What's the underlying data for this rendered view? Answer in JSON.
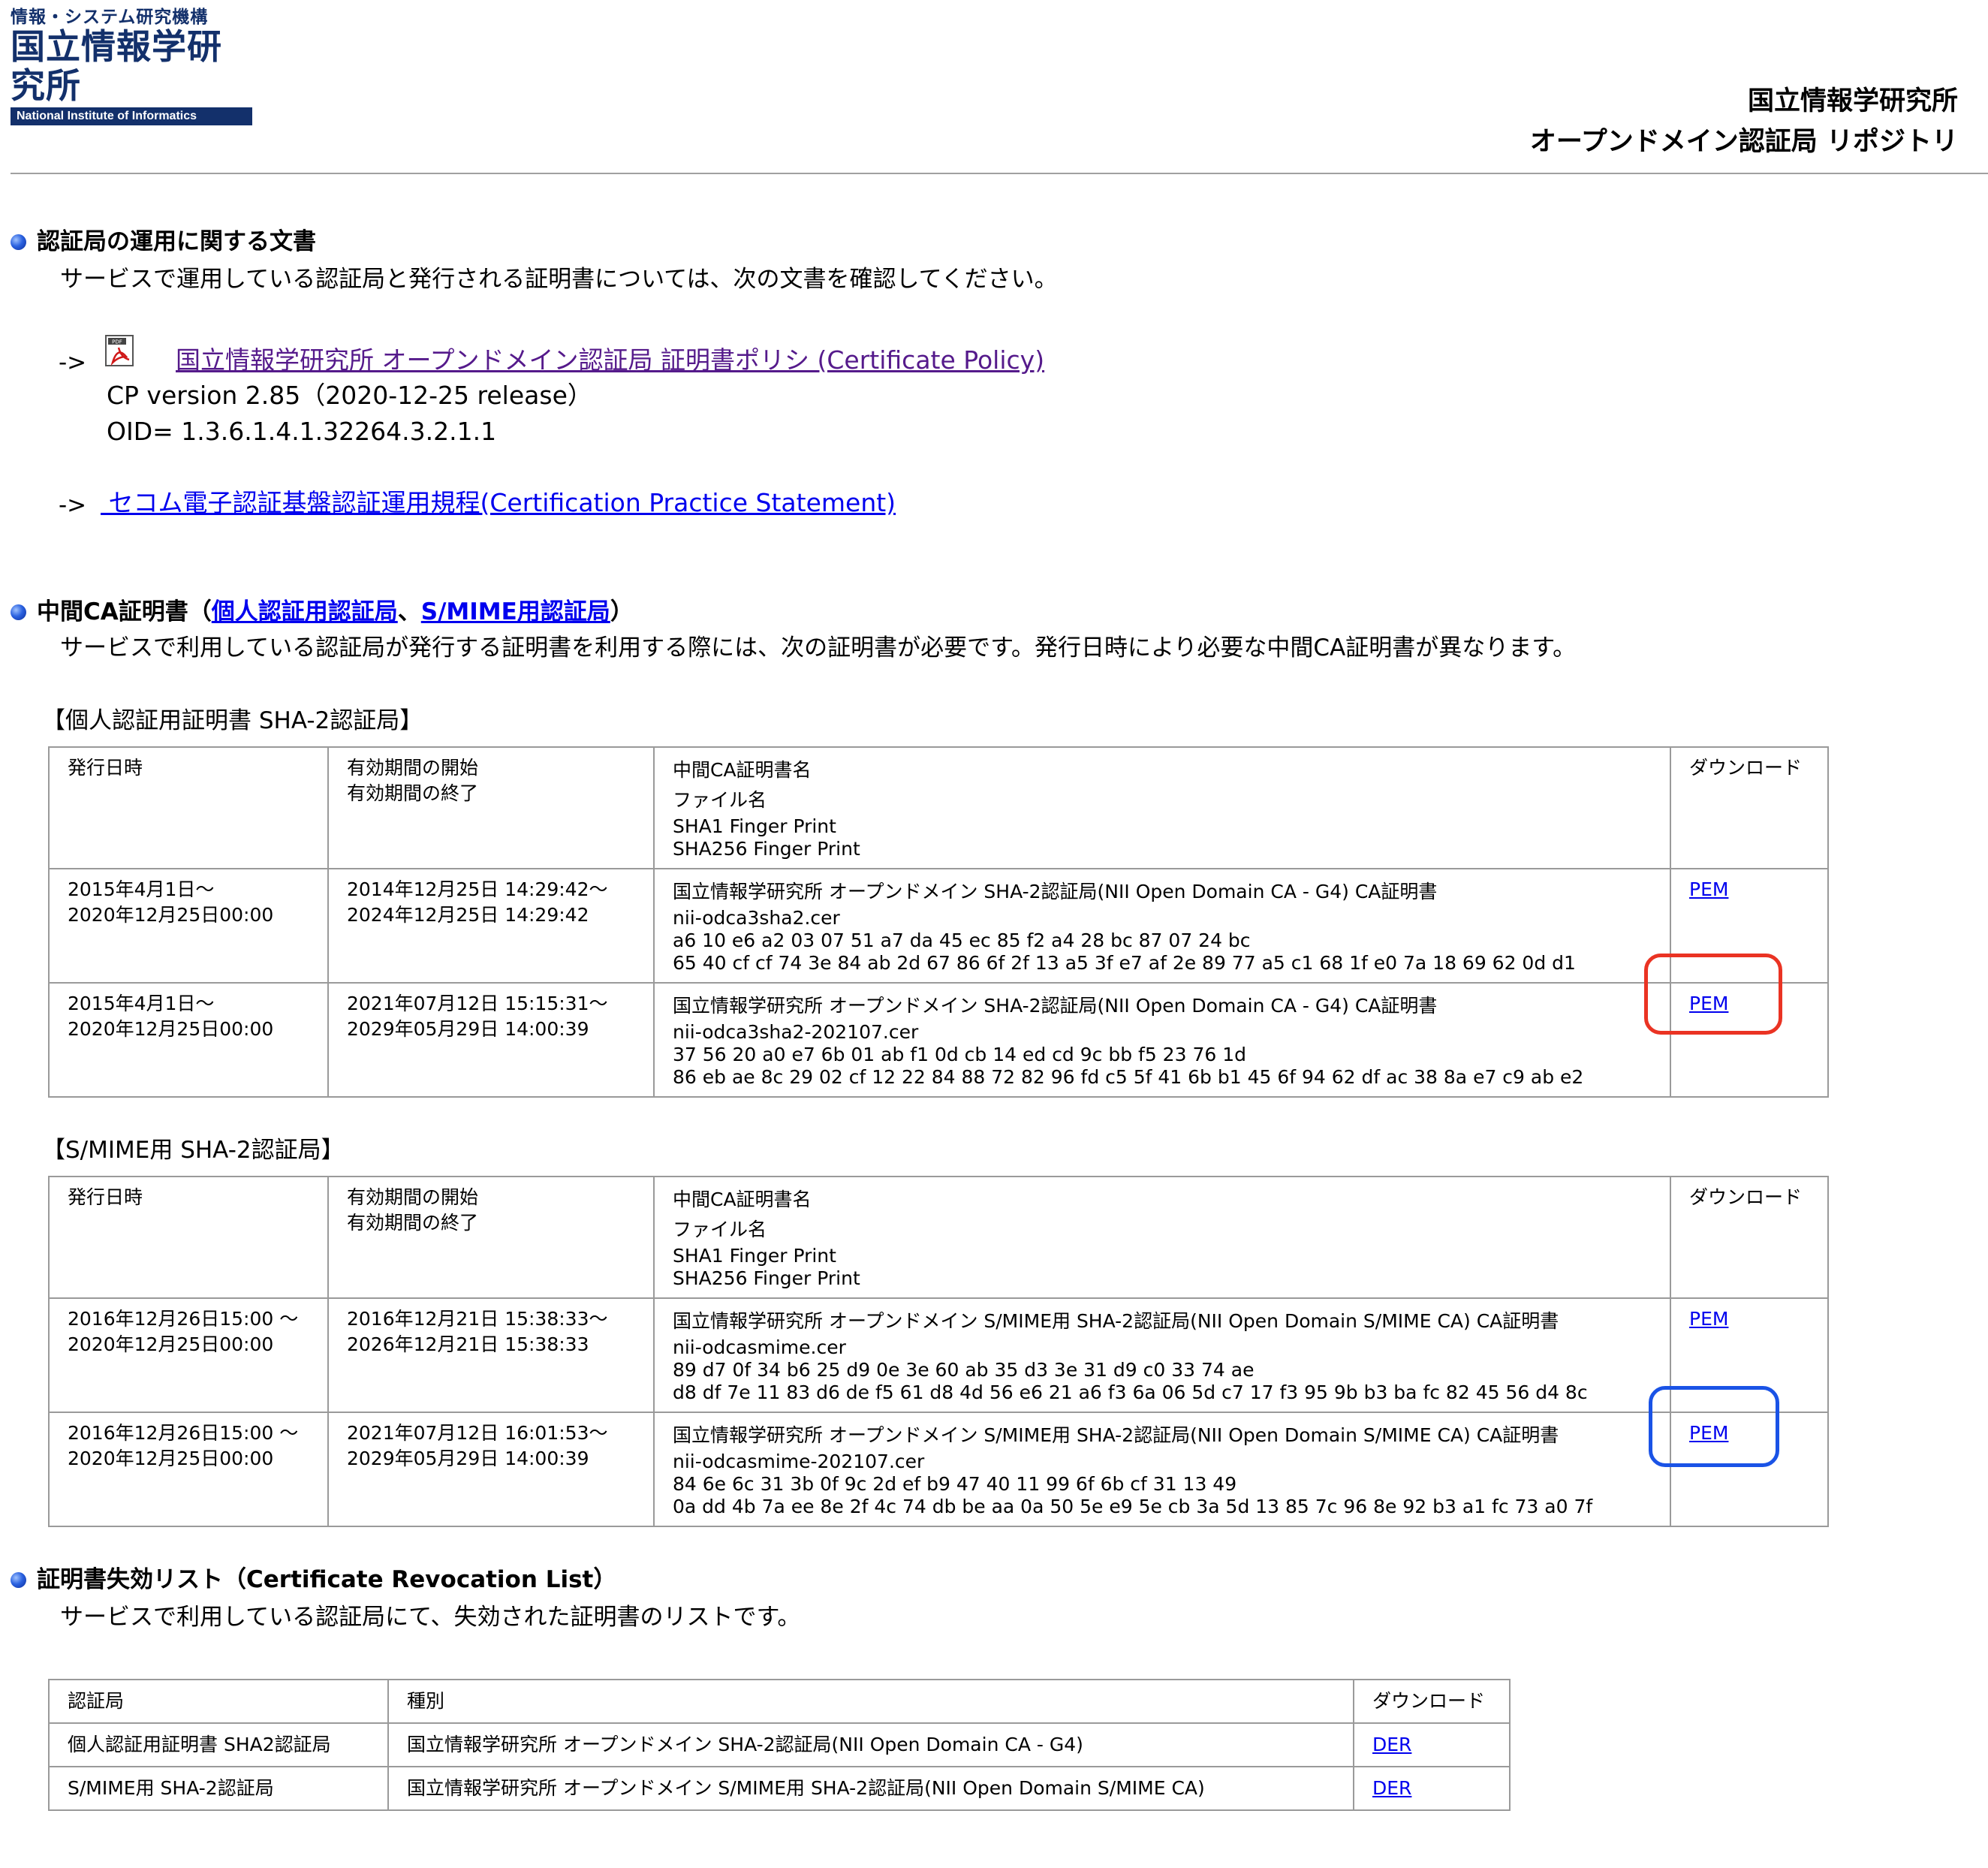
{
  "header": {
    "logo_line1": "情報・システム研究機構",
    "logo_line2": "国立情報学研究所",
    "logo_line3": "National Institute of Informatics",
    "title_line1": "国立情報学研究所",
    "title_line2": "オープンドメイン認証局 リポジトリ"
  },
  "sections": {
    "ops": {
      "heading": "認証局の運用に関する文書",
      "description": "サービスで運用している認証局と発行される証明書については、次の文書を確認してください。",
      "arrow": "->",
      "cp_link": "国立情報学研究所 オープンドメイン認証局 証明書ポリシ (Certificate Policy)",
      "cp_version": "CP version 2.85（2020-12-25 release）",
      "cp_oid": "OID= 1.3.6.1.4.1.32264.3.2.1.1",
      "cps_link": " セコム電子認証基盤認証運用規程(Certification Practice Statement)",
      "pdf_icon": "pdf-file-icon"
    },
    "intermediate": {
      "heading_prefix": "中間CA証明書（",
      "heading_link1": "個人認証用認証局",
      "heading_sep": "、",
      "heading_link2": "S/MIME用認証局",
      "heading_suffix": "）",
      "description": "サービスで利用している認証局が発行する証明書を利用する際には、次の証明書が必要です。発行日時により必要な中間CA証明書が異なります。"
    },
    "crl": {
      "heading": "証明書失効リスト（Certificate Revocation List）",
      "description": "サービスで利用している認証局にて、失効された証明書のリストです。"
    }
  },
  "table_headers": {
    "issue_date": "発行日時",
    "valid_start": "有効期間の開始",
    "valid_end": "有効期間の終了",
    "ca_name": "中間CA証明書名",
    "file_name": "ファイル名",
    "sha1": "SHA1 Finger Print",
    "sha256": "SHA256 Finger Print",
    "download": "ダウンロード"
  },
  "table_personal": {
    "title": "【個人認証用証明書 SHA-2認証局】",
    "rows": [
      {
        "issue1": "2015年4月1日〜",
        "issue2": "2020年12月25日00:00",
        "start": "2014年12月25日 14:29:42〜",
        "end": "2024年12月25日 14:29:42",
        "name": "国立情報学研究所 オープンドメイン SHA-2認証局(NII Open Domain CA - G4) CA証明書",
        "file": "nii-odca3sha2.cer",
        "sha1": "a6 10 e6 a2 03 07 51 a7 da 45 ec 85 f2 a4 28 bc 87 07 24 bc",
        "sha256": "65 40 cf cf 74 3e 84 ab 2d 67 86 6f 2f 13 a5 3f e7 af 2e 89 77 a5 c1 68 1f e0 7a 18 69 62 0d d1",
        "download": "PEM"
      },
      {
        "issue1": "2015年4月1日〜",
        "issue2": "2020年12月25日00:00",
        "start": "2021年07月12日 15:15:31〜",
        "end": "2029年05月29日 14:00:39",
        "name": "国立情報学研究所 オープンドメイン SHA-2認証局(NII Open Domain CA - G4) CA証明書",
        "file": "nii-odca3sha2-202107.cer",
        "sha1": "37 56 20 a0 e7 6b 01 ab f1 0d cb 14 ed cd 9c bb f5 23 76 1d",
        "sha256": "86 eb ae 8c 29 02 cf 12 22 84 88 72 82 96 fd c5 5f 41 6b b1 45 6f 94 62 df ac 38 8a e7 c9 ab e2",
        "download": "PEM"
      }
    ]
  },
  "table_smime": {
    "title": "【S/MIME用 SHA-2認証局】",
    "rows": [
      {
        "issue1": "2016年12月26日15:00 〜",
        "issue2": "2020年12月25日00:00",
        "start": "2016年12月21日 15:38:33〜",
        "end": "2026年12月21日 15:38:33",
        "name": "国立情報学研究所 オープンドメイン S/MIME用 SHA-2認証局(NII Open Domain S/MIME CA) CA証明書",
        "file": "nii-odcasmime.cer",
        "sha1": "89 d7 0f 34 b6 25 d9 0e 3e 60 ab 35 d3 3e 31 d9 c0 33 74 ae",
        "sha256": "d8 df 7e 11 83 d6 de f5 61 d8 4d 56 e6 21 a6 f3 6a 06 5d c7 17 f3 95 9b b3 ba fc 82 45 56 d4 8c",
        "download": "PEM"
      },
      {
        "issue1": "2016年12月26日15:00 〜",
        "issue2": "2020年12月25日00:00",
        "start": "2021年07月12日 16:01:53〜",
        "end": "2029年05月29日 14:00:39",
        "name": "国立情報学研究所 オープンドメイン S/MIME用 SHA-2認証局(NII Open Domain S/MIME CA) CA証明書",
        "file": "nii-odcasmime-202107.cer",
        "sha1": "84 6e 6c 31 3b 0f 9c 2d ef b9 47 40 11 99 6f 6b cf 31 13 49",
        "sha256": "0a dd 4b 7a ee 8e 2f 4c 74 db be aa 0a 50 5e e9 5e cb 3a 5d 13 85 7c 96 8e 92 b3 a1 fc 73 a0 7f",
        "download": "PEM"
      }
    ]
  },
  "crl_table": {
    "headers": {
      "ca": "認証局",
      "type": "種別",
      "download": "ダウンロード"
    },
    "rows": [
      {
        "ca": "個人認証用証明書 SHA2認証局",
        "type": "国立情報学研究所 オープンドメイン SHA-2認証局(NII Open Domain CA - G4)",
        "download": "DER"
      },
      {
        "ca": "S/MIME用 SHA-2認証局",
        "type": "国立情報学研究所 オープンドメイン S/MIME用 SHA-2認証局(NII Open Domain S/MIME CA)",
        "download": "DER"
      }
    ]
  },
  "colors": {
    "link": "#0000ee",
    "visited_link": "#551a8b",
    "highlight_red": "#ea3323",
    "highlight_blue": "#1a53e6",
    "logo_navy": "#13306b"
  }
}
